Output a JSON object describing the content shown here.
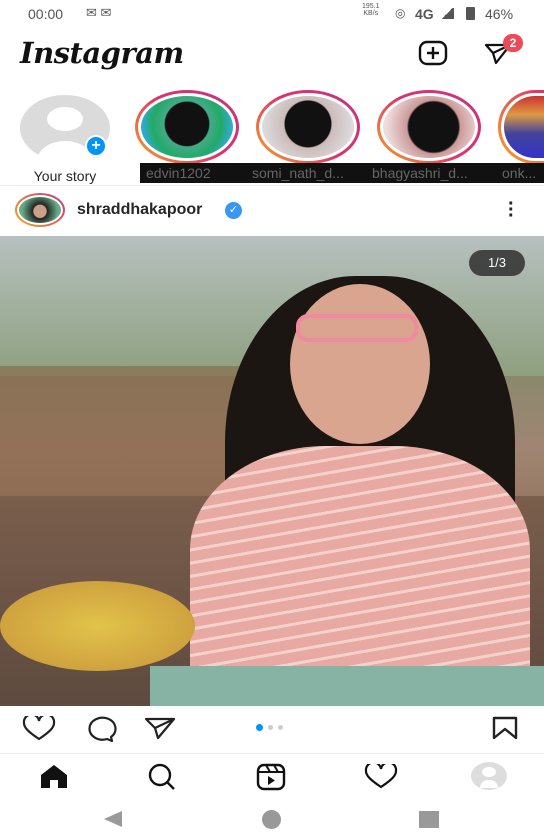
{
  "status_bar": {
    "time": "00:00",
    "speed": "195.1",
    "speed_unit": "KB/s",
    "network": "4G",
    "battery": "46%"
  },
  "header": {
    "logo": "Instagram",
    "messages_badge": "2"
  },
  "stories": [
    {
      "label": "Your story",
      "own": true
    },
    {
      "label": "edvin1202"
    },
    {
      "label": "somi_nath_d..."
    },
    {
      "label": "bhagyashri_d..."
    },
    {
      "label": "onk..."
    }
  ],
  "post": {
    "username": "shraddhakapoor",
    "verified": true,
    "image_counter": "1/3",
    "carousel": {
      "count": 3,
      "active": 1
    }
  },
  "colors": {
    "accent": "#0095f6",
    "badge": "#ed4956"
  },
  "nav": [
    "home-icon",
    "search-icon",
    "reels-icon",
    "heart-icon",
    "profile-icon"
  ]
}
